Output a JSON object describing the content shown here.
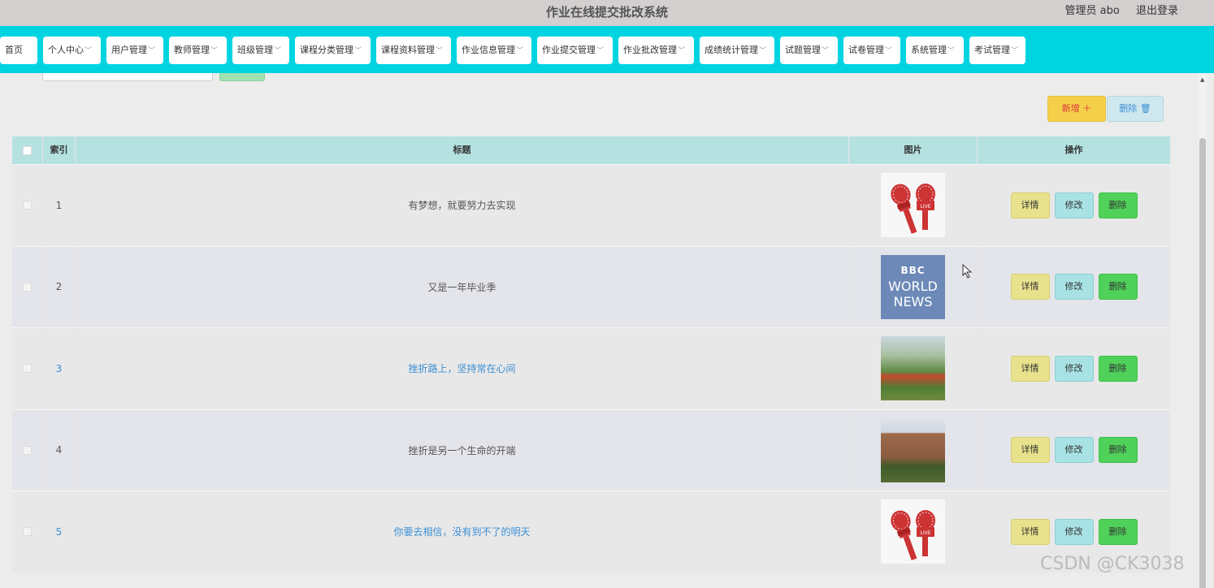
{
  "header": {
    "title": "作业在线提交批改系统",
    "user": "管理员 abo",
    "logout": "退出登录"
  },
  "nav": [
    {
      "label": "首页",
      "dropdown": false
    },
    {
      "label": "个人中心",
      "dropdown": true
    },
    {
      "label": "用户管理",
      "dropdown": true
    },
    {
      "label": "教师管理",
      "dropdown": true
    },
    {
      "label": "班级管理",
      "dropdown": true
    },
    {
      "label": "课程分类管理",
      "dropdown": true
    },
    {
      "label": "课程资料管理",
      "dropdown": true
    },
    {
      "label": "作业信息管理",
      "dropdown": true
    },
    {
      "label": "作业提交管理",
      "dropdown": true
    },
    {
      "label": "作业批改管理",
      "dropdown": true
    },
    {
      "label": "成绩统计管理",
      "dropdown": true
    },
    {
      "label": "试题管理",
      "dropdown": true
    },
    {
      "label": "试卷管理",
      "dropdown": true
    },
    {
      "label": "系统管理",
      "dropdown": true
    },
    {
      "label": "考试管理",
      "dropdown": true
    }
  ],
  "toolbar": {
    "add_label": "新增 ＋",
    "delete_label": "删除 🗑"
  },
  "table": {
    "headers": {
      "index": "索引",
      "title": "标题",
      "image": "图片",
      "ops": "操作"
    },
    "rows": [
      {
        "index": "1",
        "title": "有梦想，就要努力去实现",
        "image": "mic-live",
        "link": false
      },
      {
        "index": "2",
        "title": "又是一年毕业季",
        "image": "bbc-world-news",
        "link": false
      },
      {
        "index": "3",
        "title": "挫折路上，坚持常在心间",
        "image": "sports-field",
        "link": true
      },
      {
        "index": "4",
        "title": "挫折是另一个生命的开端",
        "image": "campus-building",
        "link": false
      },
      {
        "index": "5",
        "title": "你要去相信，没有到不了的明天",
        "image": "mic-live",
        "link": true
      }
    ],
    "row_actions": {
      "detail": "详情",
      "edit": "修改",
      "delete": "删除"
    }
  },
  "thumb_text": {
    "live": "LIVE",
    "bbc": "BBC",
    "world": "WORLD",
    "news": "NEWS"
  },
  "watermark": "CSDN @CK3038",
  "colors": {
    "nav_bg": "#00d4e1",
    "header_bg": "#d3cfcf",
    "table_head": "#b6e1e1",
    "add": "#f4d04a",
    "delete_row": "#4fd15a"
  }
}
